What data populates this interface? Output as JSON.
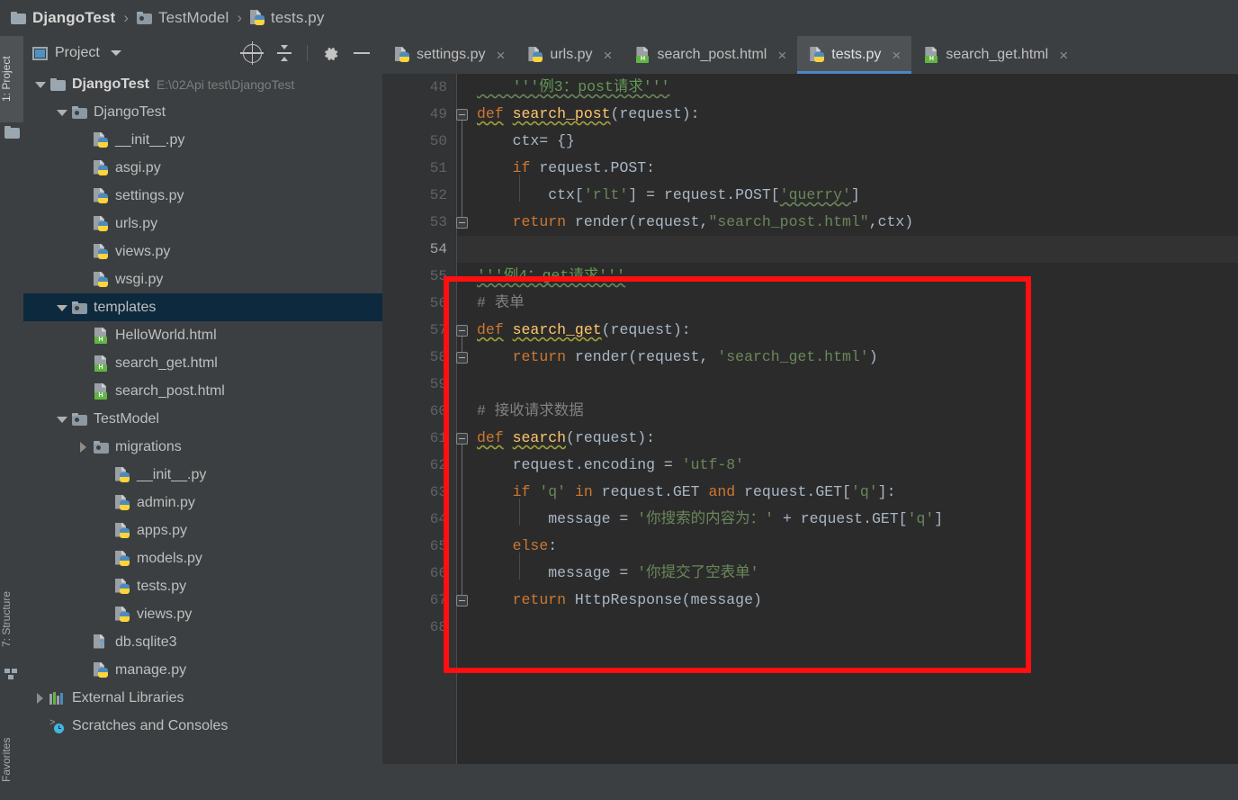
{
  "breadcrumb": {
    "items": [
      {
        "label": "DjangoTest",
        "icon": "folder-icon",
        "bold": true
      },
      {
        "label": "TestModel",
        "icon": "module-folder-icon",
        "bold": false
      },
      {
        "label": "tests.py",
        "icon": "python-file-icon",
        "bold": false
      }
    ],
    "separator": "›"
  },
  "toolstrip": {
    "tabs": [
      {
        "label": "1: Project",
        "active": true
      },
      {
        "label": "7: Structure",
        "active": false
      },
      {
        "label": "Favorites",
        "active": false
      }
    ]
  },
  "project_panel": {
    "title": "Project",
    "caret": "chevron-down-icon",
    "actions": [
      "locate-target-icon",
      "collapse-all-icon",
      "gear-icon",
      "minimize-icon"
    ],
    "tree": [
      {
        "label": "DjangoTest",
        "path": "E:\\02Api test\\DjangoTest",
        "icon": "folder-icon",
        "arrow": "down",
        "indent": 0,
        "bold": true,
        "selected": false
      },
      {
        "label": "DjangoTest",
        "path": "",
        "icon": "module-folder-icon",
        "arrow": "down",
        "indent": 1,
        "bold": false,
        "selected": false
      },
      {
        "label": "__init__.py",
        "path": "",
        "icon": "python-file-icon",
        "arrow": "none",
        "indent": 2,
        "bold": false,
        "selected": false
      },
      {
        "label": "asgi.py",
        "path": "",
        "icon": "python-file-icon",
        "arrow": "none",
        "indent": 2,
        "bold": false,
        "selected": false
      },
      {
        "label": "settings.py",
        "path": "",
        "icon": "python-file-icon",
        "arrow": "none",
        "indent": 2,
        "bold": false,
        "selected": false
      },
      {
        "label": "urls.py",
        "path": "",
        "icon": "python-file-icon",
        "arrow": "none",
        "indent": 2,
        "bold": false,
        "selected": false
      },
      {
        "label": "views.py",
        "path": "",
        "icon": "python-file-icon",
        "arrow": "none",
        "indent": 2,
        "bold": false,
        "selected": false
      },
      {
        "label": "wsgi.py",
        "path": "",
        "icon": "python-file-icon",
        "arrow": "none",
        "indent": 2,
        "bold": false,
        "selected": false
      },
      {
        "label": "templates",
        "path": "",
        "icon": "module-folder-icon",
        "arrow": "down",
        "indent": 1,
        "bold": false,
        "selected": true
      },
      {
        "label": "HelloWorld.html",
        "path": "",
        "icon": "html-file-icon",
        "arrow": "none",
        "indent": 2,
        "bold": false,
        "selected": false
      },
      {
        "label": "search_get.html",
        "path": "",
        "icon": "html-file-icon",
        "arrow": "none",
        "indent": 2,
        "bold": false,
        "selected": false
      },
      {
        "label": "search_post.html",
        "path": "",
        "icon": "html-file-icon",
        "arrow": "none",
        "indent": 2,
        "bold": false,
        "selected": false
      },
      {
        "label": "TestModel",
        "path": "",
        "icon": "module-folder-icon",
        "arrow": "down",
        "indent": 1,
        "bold": false,
        "selected": false
      },
      {
        "label": "migrations",
        "path": "",
        "icon": "module-folder-icon",
        "arrow": "right",
        "indent": 2,
        "bold": false,
        "selected": false
      },
      {
        "label": "__init__.py",
        "path": "",
        "icon": "python-file-icon",
        "arrow": "none",
        "indent": 3,
        "bold": false,
        "selected": false
      },
      {
        "label": "admin.py",
        "path": "",
        "icon": "python-file-icon",
        "arrow": "none",
        "indent": 3,
        "bold": false,
        "selected": false
      },
      {
        "label": "apps.py",
        "path": "",
        "icon": "python-file-icon",
        "arrow": "none",
        "indent": 3,
        "bold": false,
        "selected": false
      },
      {
        "label": "models.py",
        "path": "",
        "icon": "python-file-icon",
        "arrow": "none",
        "indent": 3,
        "bold": false,
        "selected": false
      },
      {
        "label": "tests.py",
        "path": "",
        "icon": "python-file-icon",
        "arrow": "none",
        "indent": 3,
        "bold": false,
        "selected": false
      },
      {
        "label": "views.py",
        "path": "",
        "icon": "python-file-icon",
        "arrow": "none",
        "indent": 3,
        "bold": false,
        "selected": false
      },
      {
        "label": "db.sqlite3",
        "path": "",
        "icon": "unknown-file-icon",
        "arrow": "none",
        "indent": 2,
        "bold": false,
        "selected": false
      },
      {
        "label": "manage.py",
        "path": "",
        "icon": "python-file-icon",
        "arrow": "none",
        "indent": 2,
        "bold": false,
        "selected": false
      },
      {
        "label": "External Libraries",
        "path": "",
        "icon": "library-icon",
        "arrow": "right",
        "indent": 0,
        "bold": false,
        "selected": false
      },
      {
        "label": "Scratches and Consoles",
        "path": "",
        "icon": "scratches-icon",
        "arrow": "none",
        "indent": 0,
        "bold": false,
        "selected": false
      }
    ]
  },
  "editor": {
    "tabs": [
      {
        "label": "settings.py",
        "icon": "python-file-icon",
        "active": false,
        "close": "×"
      },
      {
        "label": "urls.py",
        "icon": "python-file-icon",
        "active": false,
        "close": "×"
      },
      {
        "label": "search_post.html",
        "icon": "html-file-icon",
        "active": false,
        "close": "×"
      },
      {
        "label": "tests.py",
        "icon": "python-file-icon",
        "active": true,
        "close": "×"
      },
      {
        "label": "search_get.html",
        "icon": "html-file-icon",
        "active": false,
        "close": "×"
      }
    ],
    "active_tab_accent": "#4a88c7",
    "current_line": 54,
    "first_line": 48,
    "last_line": 68,
    "line_numbers": [
      48,
      49,
      50,
      51,
      52,
      53,
      54,
      55,
      56,
      57,
      58,
      59,
      60,
      61,
      62,
      63,
      64,
      65,
      66,
      67,
      68
    ],
    "lines": [
      {
        "n": 48,
        "text": "    '''例3：post请求'''"
      },
      {
        "n": 49,
        "text": "def search_post(request):"
      },
      {
        "n": 50,
        "text": "    ctx= {}"
      },
      {
        "n": 51,
        "text": "    if request.POST:"
      },
      {
        "n": 52,
        "text": "        ctx['rlt'] = request.POST['querry']"
      },
      {
        "n": 53,
        "text": "    return render(request,\"search_post.html\",ctx)"
      },
      {
        "n": 54,
        "text": ""
      },
      {
        "n": 55,
        "text": "'''例4：get请求'''"
      },
      {
        "n": 56,
        "text": "# 表单"
      },
      {
        "n": 57,
        "text": "def search_get(request):"
      },
      {
        "n": 58,
        "text": "    return render(request, 'search_get.html')"
      },
      {
        "n": 59,
        "text": ""
      },
      {
        "n": 60,
        "text": "# 接收请求数据"
      },
      {
        "n": 61,
        "text": "def search(request):"
      },
      {
        "n": 62,
        "text": "    request.encoding = 'utf-8'"
      },
      {
        "n": 63,
        "text": "    if 'q' in request.GET and request.GET['q']:"
      },
      {
        "n": 64,
        "text": "        message = '你搜索的内容为：' + request.GET['q']"
      },
      {
        "n": 65,
        "text": "    else:"
      },
      {
        "n": 66,
        "text": "        message = '你提交了空表单'"
      },
      {
        "n": 67,
        "text": "    return HttpResponse(message)"
      },
      {
        "n": 68,
        "text": ""
      }
    ]
  },
  "annotation": {
    "type": "red-rectangle-highlight",
    "color": "#ff0f0f",
    "border_width": 6,
    "covers_lines": "54-68"
  },
  "colors": {
    "editor_bg": "#2b2b2b",
    "gutter_bg": "#313335",
    "panel_bg": "#3c3f41",
    "selection_bg": "#0d293e",
    "current_line_bg": "#323232",
    "keyword": "#cc7832",
    "string": "#6a8759",
    "docstring": "#629755",
    "comment": "#808080",
    "function": "#ffc66d",
    "text": "#a9b7c6"
  }
}
